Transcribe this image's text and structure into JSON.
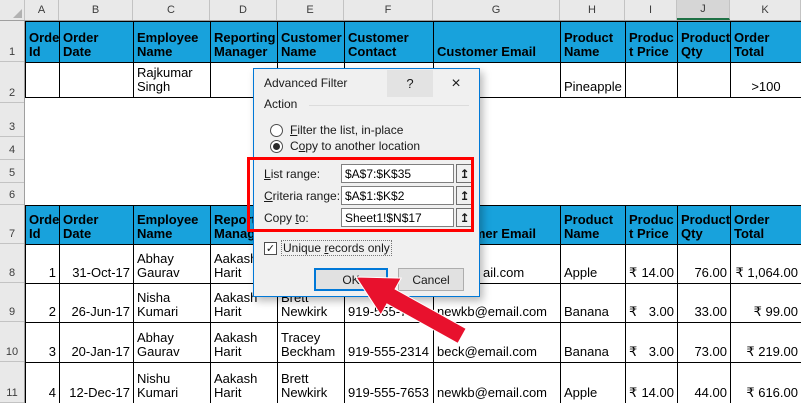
{
  "colors": {
    "header_blue": "#18A2DC",
    "selected_green": "#1E7145",
    "annotation_red": "#FF0000",
    "arrow_red": "#E8112D"
  },
  "sheet": {
    "column_letters": [
      "A",
      "B",
      "C",
      "D",
      "E",
      "F",
      "G",
      "H",
      "I",
      "J",
      "K"
    ],
    "selected_column": "J",
    "row_numbers": [
      "1",
      "2",
      "3",
      "4",
      "5",
      "6",
      "7",
      "8",
      "9",
      "10",
      "11"
    ],
    "header_labels": [
      "Order\nId",
      "Order Date",
      "Employee\nName",
      "Reporting\nManager",
      "Customer\nName",
      "Customer\nContact",
      "Customer Email",
      "Product\nName",
      "Produc\nt Price",
      "Product\nQty",
      "Order\nTotal"
    ],
    "criteria_row": [
      "",
      "",
      "Rajkumar\nSingh",
      "",
      "",
      "",
      "",
      "Pineapple",
      "",
      "",
      ">100"
    ],
    "data_rows": [
      [
        "1",
        "31-Oct-17",
        "Abhay\nGaurav",
        "Aakash\nHarit",
        "",
        "",
        "ail.com",
        "Apple",
        "₹ 14.00",
        "76.00",
        "₹ 1,064.00"
      ],
      [
        "2",
        "26-Jun-17",
        "Nisha\nKumari",
        "Aakash\nHarit",
        "Brett\nNewkirk",
        "919-555-7653",
        "newkb@email.com",
        "Banana",
        "₹ 3.00",
        "33.00",
        "₹ 99.00"
      ],
      [
        "3",
        "20-Jan-17",
        "Abhay\nGaurav",
        "Aakash\nHarit",
        "Tracey\nBeckham",
        "919-555-2314",
        "beck@email.com",
        "Banana",
        "₹ 3.00",
        "73.00",
        "₹ 219.00"
      ],
      [
        "4",
        "12-Dec-17",
        "Nishu\nKumari",
        "Aakash\nHarit",
        "Brett\nNewkirk",
        "919-555-7653",
        "newkb@email.com",
        "Apple",
        "₹ 14.00",
        "44.00",
        "₹ 616.00"
      ]
    ]
  },
  "dialog": {
    "title": "Advanced Filter",
    "help_glyph": "?",
    "close_glyph": "×",
    "action_label": "Action",
    "radio_in_place": {
      "pre": "",
      "accel": "F",
      "post": "ilter the list, in-place",
      "selected": false
    },
    "radio_copy": {
      "pre": "C",
      "accel": "o",
      "post": "py to another location",
      "selected": true
    },
    "list_range": {
      "pre": "",
      "accel": "L",
      "post": "ist range:",
      "value": "$A$7:$K$35"
    },
    "criteria_range": {
      "pre": "",
      "accel": "C",
      "post": "riteria range:",
      "value": "$A$1:$K$2"
    },
    "copy_to": {
      "pre": "Copy ",
      "accel": "t",
      "post": "o:",
      "value": "Sheet1!$N$17"
    },
    "range_picker_glyph": "↥",
    "unique_checkbox": {
      "pre": "Unique ",
      "accel": "r",
      "post": "ecords only",
      "checked": true,
      "check_glyph": "✓"
    },
    "ok_label": "OK",
    "cancel_label": "Cancel"
  }
}
